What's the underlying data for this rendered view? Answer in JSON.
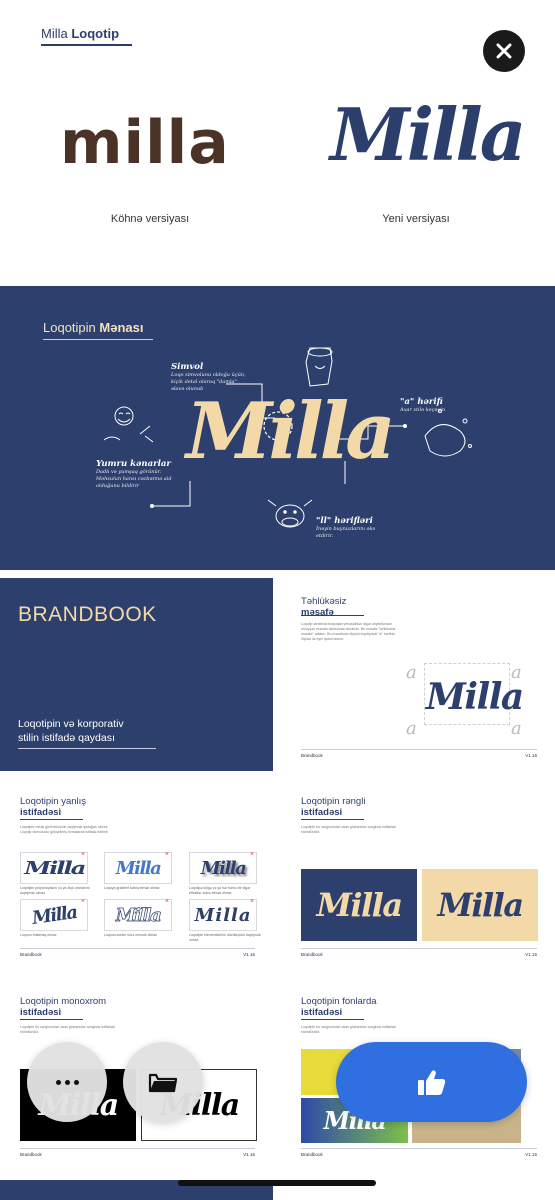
{
  "logo_section": {
    "title_normal": "Milla",
    "title_bold": "Loqotip",
    "old_logo_text": "milla",
    "new_logo_text": "Milla",
    "old_caption": "Köhnə versiyası",
    "new_caption": "Yeni versiyası"
  },
  "meaning_section": {
    "title_normal": "Loqotipin",
    "title_accent": "Mənası",
    "logo_text": "Milla",
    "notes": {
      "simvol_title": "Simvol",
      "simvol_text": "Loqo simvolunu oldoğu üçün, kiçik detal olaraq \"damla\" əlavə olunub",
      "a_title": "\"a\" hərifi",
      "a_text": "Axar stilə keçəyin",
      "yumru_title": "Yumru kənarlar",
      "yumru_text": "Dadlı və yumşaq görünür. Məhsulun hansı cəzbətmə aid olduğunu bildirir",
      "ll_title": "\"ll\" hərifləri",
      "ll_text": "İnəyin buynuzlarını əks etdirir."
    }
  },
  "slides": {
    "brandbook": {
      "title": "BRANDBOOK",
      "subtitle_line1": "Loqotipin və korporativ",
      "subtitle_line2": "stilin istifadə qaydası"
    },
    "safe_distance": {
      "title_line1": "Təhlükəsiz",
      "title_line2": "məsafə",
      "desc": "Loqotip ətrafında boşluqda yerləşdirilən digər obyektlərdən müəyyən məsafə ölçüsündə olmalıdır. Bu məsafə \"təhlükəsiz məsafə\" adlanır. Bu məsafənin ölçüsü loqotipdəki \"a\" hərfinin ölçüsü ilə eyni qəbul olunur.",
      "a_letter": "a",
      "logo_text": "Milla",
      "footer_left": "Brandbook",
      "footer_right": "V1.16"
    },
    "wrong_use": {
      "title_line1": "Loqotipin yanlış",
      "title_line2": "istifadəsi",
      "desc": "Loqotipin vizual görüntüsünün dəyişmək qadağan olunur. Loqotip nümunədə göstərilmiş formalarda istifadə edilmir.",
      "logo_text": "Milla",
      "x_mark": "×",
      "captions": [
        "Loqotipin proporsiyasını və ya ölçü oranlarını dəyişmək olmaz",
        "Loqoya gradient tətbiq etmək olmaz",
        "Loqotipə kölgə və ya hər hansı bir digər effektlər əlavə etmək olmaz",
        "Loqonu fırlatmaq olmaz",
        "Loqonu kontur üzrə vermək olmaz",
        "Loqotipin elementlərinin düzülüşünü dəyişmək olmaz"
      ],
      "footer_left": "Brandbook",
      "footer_right": "V1.16"
    },
    "colored": {
      "title_line1": "Loqotipin rəngli",
      "title_line2": "istifadəsi",
      "desc": "Loqotipin bu rənglərindən əsas göstəricilər rəngində istifadəsi mümkündür.",
      "logo_text": "Milla",
      "footer_left": "Brandbook",
      "footer_right": "V1.16"
    },
    "mono": {
      "title_line1": "Loqotipin monoxrom",
      "title_line2": "istifadəsi",
      "desc": "Loqotipin bu rənglərindən əsas göstəricilər rəngində istifadəsi mümkündür.",
      "logo_text_black": "Milla",
      "logo_text_white": "Milla",
      "footer_left": "Brandbook",
      "footer_right": "V1.16"
    },
    "fonts": {
      "title_line1": "Loqotipin fonlarda",
      "title_line2": "istifadəsi",
      "desc": "Loqotipin bu rənglərindən əsas göstəricilər rəngində istifadəsi mümkündür.",
      "logo_text": "Milla",
      "footer_left": "Brandbook",
      "footer_right": "V1.16"
    }
  },
  "controls": {
    "close_icon": "close-icon",
    "more_icon": "more-icon",
    "folder_icon": "folder-icon",
    "like_icon": "thumbs-up-icon"
  },
  "colors": {
    "navy": "#2d3f6c",
    "cream": "#f3d9a8",
    "brown": "#4a3326",
    "accent_blue": "#2f6fe0",
    "red_x": "#e0403c"
  }
}
